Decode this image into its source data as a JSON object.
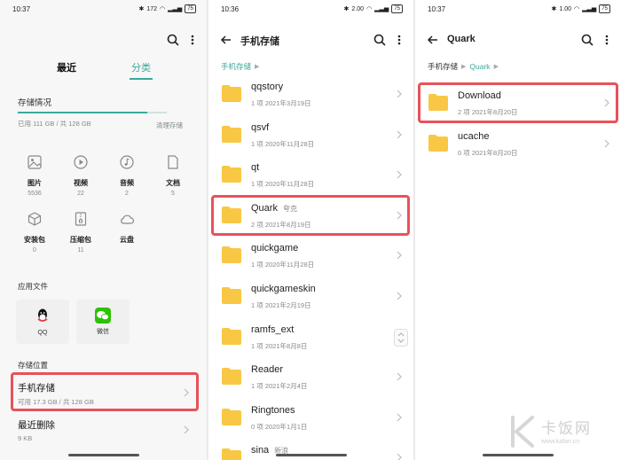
{
  "panel1": {
    "status": {
      "time": "10:37",
      "battery": "75",
      "speed": "172"
    },
    "tabs": {
      "recent": "最近",
      "category": "分类"
    },
    "storage": {
      "title": "存储情况",
      "used": "已用 111 GB / 共 128 GB",
      "used_fraction": 0.87,
      "clean": "清理存储"
    },
    "categories": [
      {
        "label": "图片",
        "count": "5536",
        "icon": "image-icon"
      },
      {
        "label": "视频",
        "count": "22",
        "icon": "video-icon"
      },
      {
        "label": "音频",
        "count": "2",
        "icon": "music-icon"
      },
      {
        "label": "文档",
        "count": "5",
        "icon": "document-icon"
      },
      {
        "label": "安装包",
        "count": "0",
        "icon": "package-icon"
      },
      {
        "label": "压缩包",
        "count": "11",
        "icon": "archive-icon"
      },
      {
        "label": "云盘",
        "count": "",
        "icon": "cloud-icon"
      }
    ],
    "app_files": {
      "title": "应用文件",
      "apps": [
        {
          "label": "QQ"
        },
        {
          "label": "微信"
        }
      ]
    },
    "locations": {
      "title": "存储位置",
      "items": [
        {
          "name": "手机存储",
          "sub": "可用 17.3 GB / 共 128 GB"
        },
        {
          "name": "最近删除",
          "sub": "9 KB"
        }
      ]
    }
  },
  "panel2": {
    "status": {
      "time": "10:36",
      "battery": "75",
      "speed": "2.00"
    },
    "title": "手机存储",
    "breadcrumb": [
      "手机存储"
    ],
    "folders": [
      {
        "name": "qqstory",
        "tag": "",
        "meta": "1 项   2021年3月19日"
      },
      {
        "name": "qsvf",
        "tag": "",
        "meta": "1 项   2020年11月28日"
      },
      {
        "name": "qt",
        "tag": "",
        "meta": "1 项   2020年11月28日"
      },
      {
        "name": "Quark",
        "tag": "夸克",
        "meta": "2 项   2021年8月19日"
      },
      {
        "name": "quickgame",
        "tag": "",
        "meta": "1 项   2020年11月28日"
      },
      {
        "name": "quickgameskin",
        "tag": "",
        "meta": "1 项   2021年2月19日"
      },
      {
        "name": "ramfs_ext",
        "tag": "",
        "meta": "1 项   2021年8月8日"
      },
      {
        "name": "Reader",
        "tag": "",
        "meta": "1 项   2021年2月4日"
      },
      {
        "name": "Ringtones",
        "tag": "",
        "meta": "0 项   2020年1月1日"
      },
      {
        "name": "sina",
        "tag": "新浪",
        "meta": ""
      }
    ]
  },
  "panel3": {
    "status": {
      "time": "10:37",
      "battery": "75",
      "speed": "1.00"
    },
    "title": "Quark",
    "breadcrumb": [
      "手机存储",
      "Quark"
    ],
    "folders": [
      {
        "name": "Download",
        "meta": "2 项   2021年8月20日"
      },
      {
        "name": "ucache",
        "meta": "0 项   2021年8月20日"
      }
    ]
  },
  "watermark": {
    "text": "卡饭网",
    "url": "www.kafan.cn"
  },
  "colors": {
    "accent": "#3ba99a",
    "highlight": "#e8525a",
    "folder": "#f8c744"
  }
}
